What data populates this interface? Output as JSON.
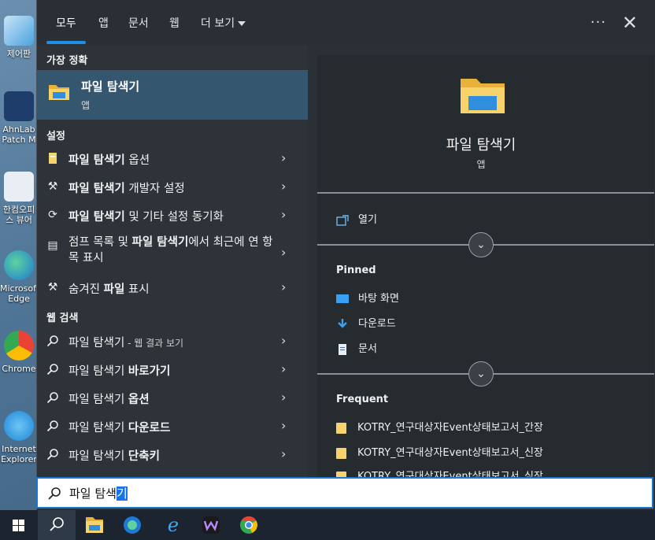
{
  "desktop": {
    "icons": [
      {
        "label": "제어판"
      },
      {
        "label": "AhnLab Patch M"
      },
      {
        "label": "한컴오피스 뷰어"
      },
      {
        "label": "Microsoft Edge"
      },
      {
        "label": "Chrome"
      },
      {
        "label": "Internet Explorer"
      }
    ]
  },
  "tabs": [
    "모두",
    "앱",
    "문서",
    "웹",
    "더 보기"
  ],
  "more_dots": "···",
  "close_glyph": "✕",
  "best_match": {
    "heading": "가장 정확",
    "name": "파일 탐색기",
    "type": "앱"
  },
  "settings": {
    "heading": "설정",
    "items": [
      {
        "bold": "파일 탐색기",
        "rest": " 옵션"
      },
      {
        "bold": "파일 탐색기",
        "rest": " 개발자 설정"
      },
      {
        "bold": "파일 탐색기",
        "rest": " 및 기타 설정 동기화"
      },
      {
        "pre": "점프 목록 및 ",
        "bold": "파일 탐색기",
        "rest": "에서 최근에 연 항목 표시"
      },
      {
        "pre": "숨겨진 ",
        "bold": "파일",
        "rest": " 표시"
      }
    ]
  },
  "web": {
    "heading": "웹 검색",
    "items": [
      {
        "plain": "파일 탐색기",
        "small": " - 웹 결과 보기"
      },
      {
        "plain": "파일 탐색기 ",
        "bold": "바로가기"
      },
      {
        "plain": "파일 탐색기 ",
        "bold": "옵션"
      },
      {
        "plain": "파일 탐색기 ",
        "bold": "다운로드"
      },
      {
        "plain": "파일 탐색기 ",
        "bold": "단축키"
      }
    ]
  },
  "preview": {
    "title": "파일 탐색기",
    "subtitle": "앱",
    "open_label": "열기",
    "pinned_heading": "Pinned",
    "pinned": [
      "바탕 화면",
      "다운로드",
      "문서"
    ],
    "frequent_heading": "Frequent",
    "frequent": [
      "KOTRY_연구대상자Event상태보고서_간장",
      "KOTRY_연구대상자Event상태보고서_신장",
      "KOTRY_연구대상자Event상태보고서_심장"
    ]
  },
  "search": {
    "typed": "파일 탐색",
    "selected": "기"
  },
  "colors": {
    "accent": "#1d8fe8",
    "highlight_row": "#35566f",
    "folder_yellow": "#f6d46b"
  }
}
